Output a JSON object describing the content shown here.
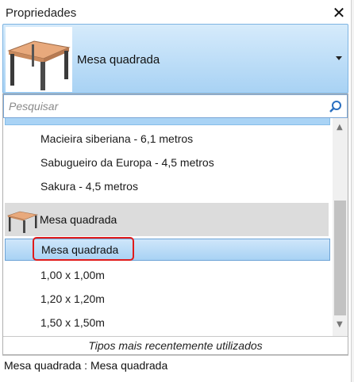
{
  "panel": {
    "title": "Propriedades",
    "close_glyph": "✕"
  },
  "type_selector": {
    "selected_type": "Mesa quadrada",
    "thumb_icon": "square-table-icon",
    "arrow_icon": "dropdown-arrow-icon"
  },
  "search": {
    "placeholder": "Pesquisar",
    "icon": "search-icon"
  },
  "list": {
    "items": [
      "Macieira siberiana - 6,1 metros",
      "Sabugueiro da Europa - 4,5 metros",
      "Sakura - 4,5 metros"
    ],
    "family": {
      "label": "Mesa quadrada",
      "icon": "square-table-icon"
    },
    "selected_item": "Mesa quadrada",
    "size_items": [
      "1,00 x 1,00m",
      "1,20 x 1,20m",
      "1,50 x 1,50m"
    ],
    "recent_label": "Tipos mais recentemente utilizados"
  },
  "footer": {
    "text": "Mesa quadrada : Mesa quadrada"
  },
  "colors": {
    "selection_blue": "#a8d2f4",
    "highlight_red": "#e01b1b",
    "family_gray": "#dcdcdc"
  }
}
